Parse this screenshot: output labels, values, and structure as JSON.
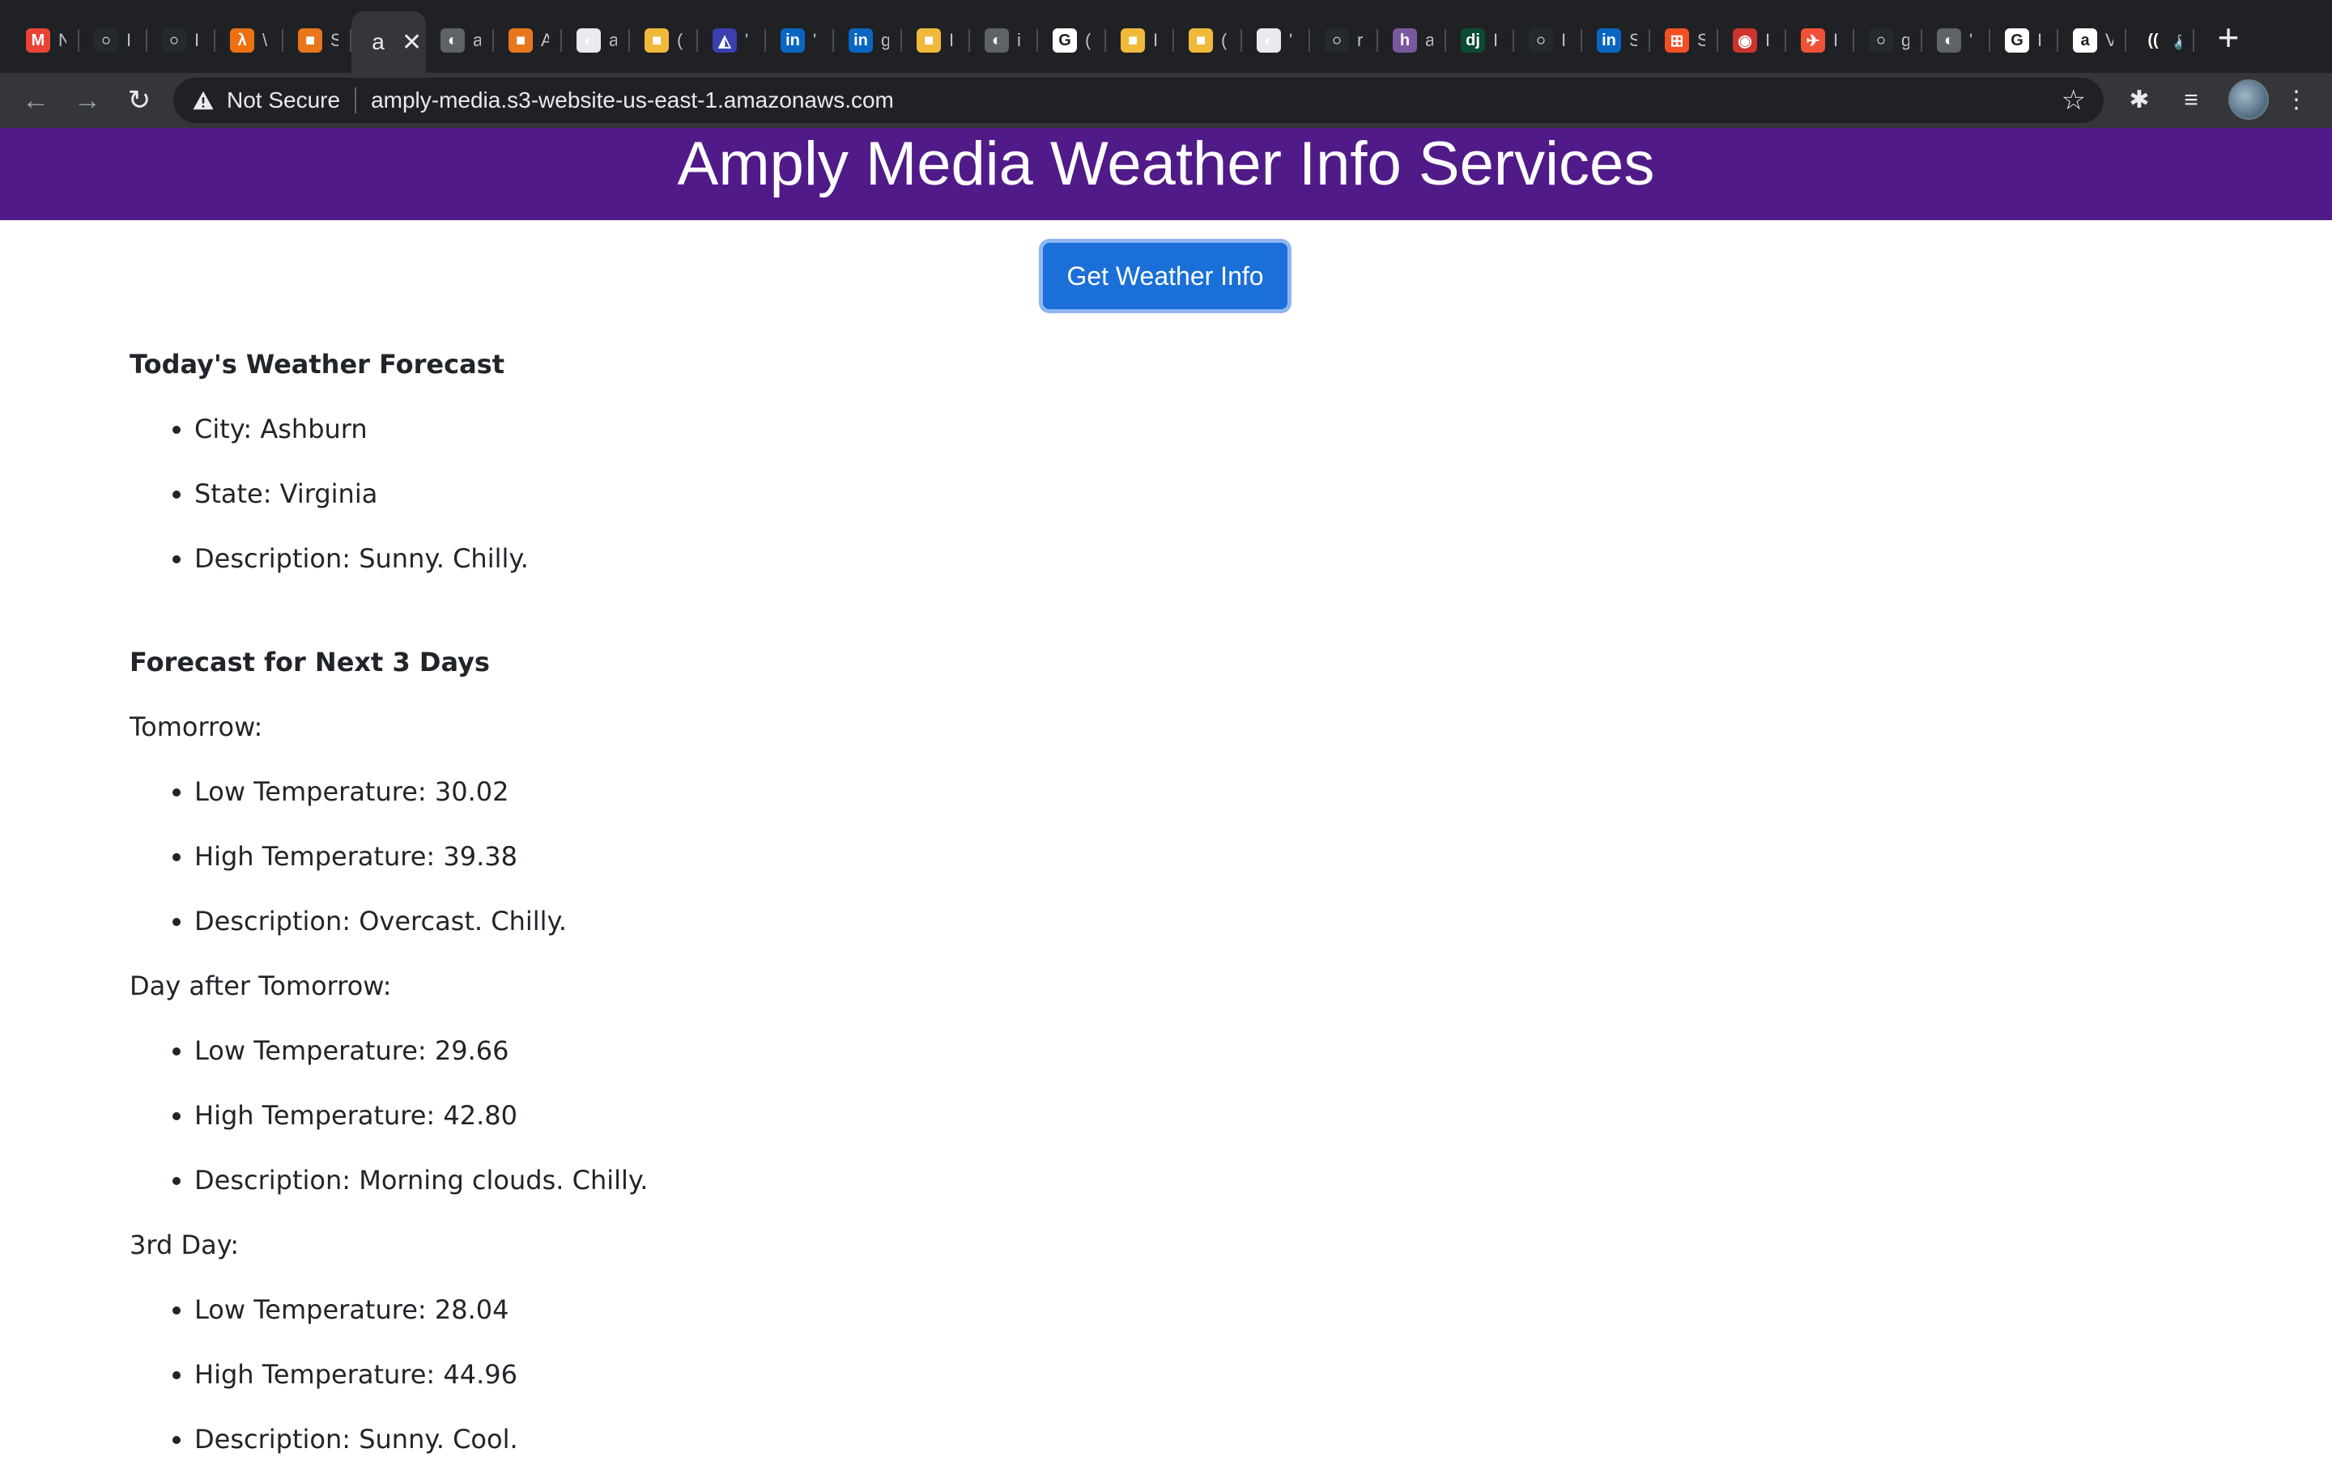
{
  "browser": {
    "tabs": [
      {
        "icon": "gmail-icon",
        "label": "M",
        "color": "#ea4335",
        "title": "N"
      },
      {
        "icon": "github-icon",
        "label": "○",
        "color": "#24292e",
        "title": "I"
      },
      {
        "icon": "github-icon",
        "label": "○",
        "color": "#24292e",
        "title": "I"
      },
      {
        "icon": "aws-lambda-icon",
        "label": "λ",
        "color": "#ec7211",
        "title": "\\"
      },
      {
        "icon": "aws-box-icon",
        "label": "■",
        "color": "#e8761c",
        "title": "S"
      },
      {
        "icon": "amazon-letter-icon",
        "label": "a",
        "color": "#35363a",
        "title": "",
        "active": true
      },
      {
        "icon": "globe-icon",
        "label": "◐",
        "color": "#5f6368",
        "title": "a"
      },
      {
        "icon": "aws-box-icon",
        "label": "■",
        "color": "#e8761c",
        "title": "A"
      },
      {
        "icon": "globe-icon",
        "label": "◐",
        "color": "#e8eaed",
        "title": "a"
      },
      {
        "icon": "package-icon",
        "label": "■",
        "color": "#f0b93a",
        "title": "("
      },
      {
        "icon": "vega-icon",
        "label": "◭",
        "color": "#3b3fb0",
        "title": "'"
      },
      {
        "icon": "linkedin-icon",
        "label": "in",
        "color": "#0a66c2",
        "title": "'"
      },
      {
        "icon": "linkedin-icon",
        "label": "in",
        "color": "#0a66c2",
        "title": "g"
      },
      {
        "icon": "package-icon",
        "label": "■",
        "color": "#f0b93a",
        "title": "I"
      },
      {
        "icon": "globe-icon",
        "label": "◐",
        "color": "#5f6368",
        "title": "i"
      },
      {
        "icon": "google-icon",
        "label": "G",
        "color": "#ffffff",
        "title": "("
      },
      {
        "icon": "package-icon",
        "label": "■",
        "color": "#f0b93a",
        "title": "I"
      },
      {
        "icon": "package-icon",
        "label": "■",
        "color": "#f0b93a",
        "title": "("
      },
      {
        "icon": "globe-icon",
        "label": "◐",
        "color": "#e8eaed",
        "title": "'"
      },
      {
        "icon": "github-icon",
        "label": "○",
        "color": "#24292e",
        "title": "r"
      },
      {
        "icon": "heroku-icon",
        "label": "h",
        "color": "#79589f",
        "title": "a"
      },
      {
        "icon": "django-icon",
        "label": "dj",
        "color": "#0c4b33",
        "title": "I"
      },
      {
        "icon": "github-icon",
        "label": "○",
        "color": "#24292e",
        "title": "I"
      },
      {
        "icon": "linkedin-icon",
        "label": "in",
        "color": "#0a66c2",
        "title": "S"
      },
      {
        "icon": "microsoft-icon",
        "label": "⊞",
        "color": "#f25022",
        "title": "S"
      },
      {
        "icon": "ruby-icon",
        "label": "◉",
        "color": "#cc342d",
        "title": "I"
      },
      {
        "icon": "swift-icon",
        "label": "✈",
        "color": "#f05138",
        "title": "I"
      },
      {
        "icon": "github-icon",
        "label": "○",
        "color": "#24292e",
        "title": "g"
      },
      {
        "icon": "globe-icon",
        "label": "◐",
        "color": "#5f6368",
        "title": "'"
      },
      {
        "icon": "google-icon",
        "label": "G",
        "color": "#ffffff",
        "title": "I"
      },
      {
        "icon": "amazon-icon",
        "label": "a",
        "color": "#ffffff",
        "title": "V"
      },
      {
        "icon": "audio-icon",
        "label": "((",
        "color": "#202124",
        "title": "🔈"
      }
    ],
    "close_glyph": "✕",
    "new_tab_glyph": "+",
    "security_label": "Not Secure",
    "url": "amply-media.s3-website-us-east-1.amazonaws.com"
  },
  "page": {
    "title": "Amply Media Weather Info Services",
    "button_label": "Get Weather Info",
    "today": {
      "heading": "Today's Weather Forecast",
      "items": [
        "City: Ashburn",
        "State: Virginia",
        "Description: Sunny. Chilly."
      ]
    },
    "forecast": {
      "heading": "Forecast for Next 3 Days",
      "days": [
        {
          "label": "Tomorrow:",
          "items": [
            "Low Temperature: 30.02",
            "High Temperature: 39.38",
            "Description: Overcast. Chilly."
          ]
        },
        {
          "label": "Day after Tomorrow:",
          "items": [
            "Low Temperature: 29.66",
            "High Temperature: 42.80",
            "Description: Morning clouds. Chilly."
          ]
        },
        {
          "label": "3rd Day:",
          "items": [
            "Low Temperature: 28.04",
            "High Temperature: 44.96",
            "Description: Sunny. Cool."
          ]
        }
      ]
    }
  },
  "colors": {
    "banner": "#501b88",
    "button": "#1a6fd8",
    "chrome_dark": "#202124",
    "chrome_toolbar": "#35363a"
  }
}
